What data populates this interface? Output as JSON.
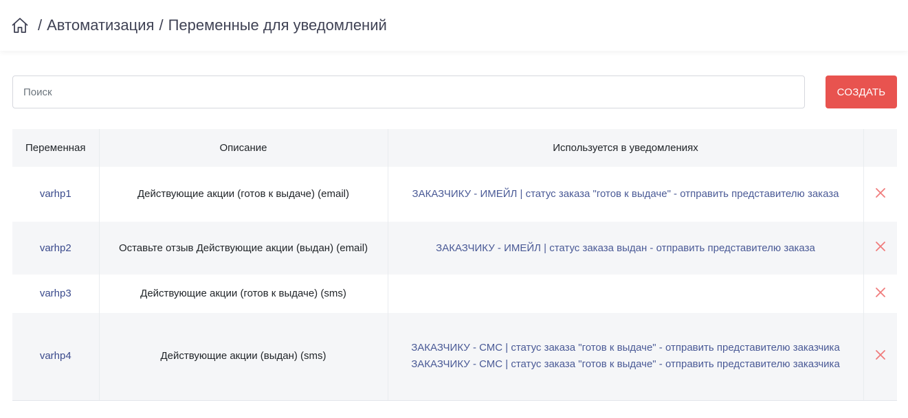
{
  "breadcrumb": {
    "home_icon": "home-icon",
    "items": [
      "Автоматизация",
      "Переменные для уведомлений"
    ],
    "separator": "/"
  },
  "search": {
    "placeholder": "Поиск",
    "value": ""
  },
  "create_button": {
    "label": "СОЗДАТЬ",
    "color": "#e8534f"
  },
  "table": {
    "headers": [
      "Переменная",
      "Описание",
      "Используется в уведомлениях",
      ""
    ],
    "rows": [
      {
        "variable": "varhp1",
        "description": "Действующие акции (готов к выдаче) (email)",
        "notifications": [
          "ЗАКАЗЧИКУ - ИМЕЙЛ | статус заказа \"готов к выдаче\" - отправить представителю заказа"
        ]
      },
      {
        "variable": "varhp2",
        "description": "Оставьте отзыв Действующие акции (выдан) (email)",
        "notifications": [
          "ЗАКАЗЧИКУ - ИМЕЙЛ | статус заказа выдан - отправить представителю заказа"
        ]
      },
      {
        "variable": "varhp3",
        "description": "Действующие акции (готов к выдаче) (sms)",
        "notifications": []
      },
      {
        "variable": "varhp4",
        "description": "Действующие акции (выдан) (sms)",
        "notifications": [
          "ЗАКАЗЧИКУ - СМС | статус заказа \"готов к выдаче\" - отправить представителю заказчика",
          "ЗАКАЗЧИКУ - СМС | статус заказа \"готов к выдаче\" - отправить представителю заказчика"
        ]
      }
    ],
    "delete_icon": "close-icon",
    "delete_color": "#f07b7b",
    "link_color": "#3a4a8c"
  }
}
